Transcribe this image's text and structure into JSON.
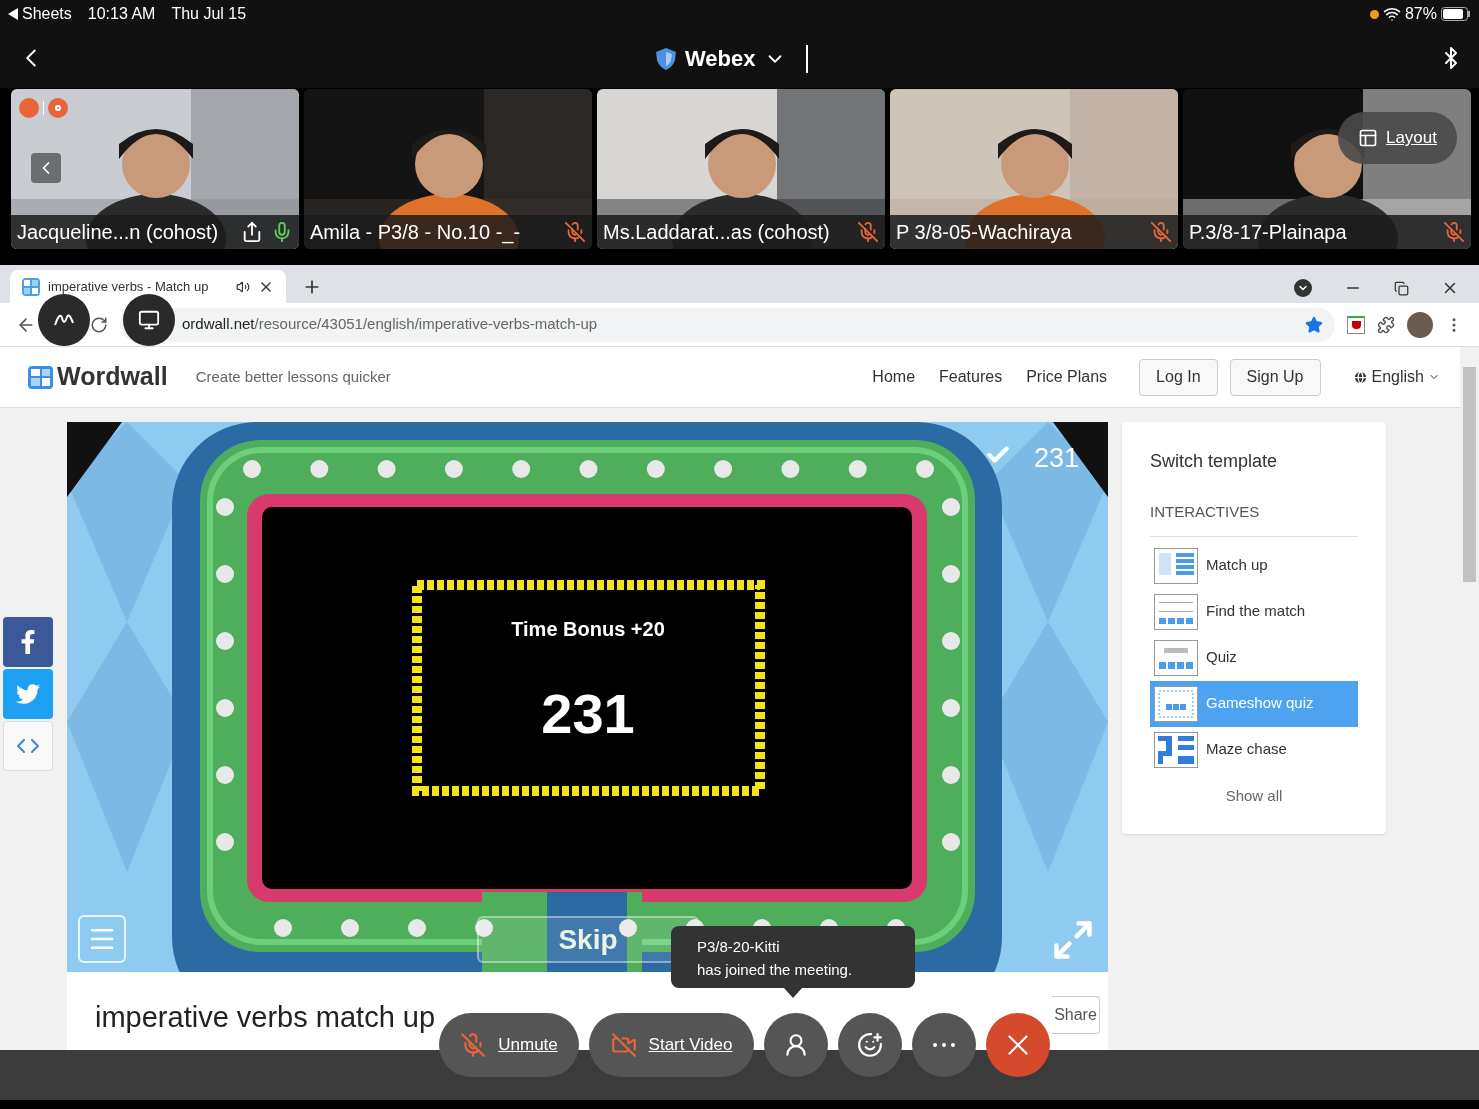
{
  "status_bar": {
    "back_app": "Sheets",
    "time": "10:13 AM",
    "date": "Thu Jul 15",
    "battery": "87%"
  },
  "meeting_header": {
    "title": "Webex"
  },
  "participants": [
    {
      "name": "Jacqueline...n (cohost)",
      "muted": false,
      "presenting": true
    },
    {
      "name": "Amila - P3/8 - No.10 -_-",
      "muted": true,
      "presenting": false
    },
    {
      "name": "Ms.Laddarat...as (cohost)",
      "muted": true,
      "presenting": false
    },
    {
      "name": "P 3/8-05-Wachiraya",
      "muted": true,
      "presenting": false
    },
    {
      "name": "P.3/8-17-Plainapa",
      "muted": true,
      "presenting": false
    }
  ],
  "layout_button": "Layout",
  "browser": {
    "tab_title": "imperative verbs - Match up",
    "url_host": "ordwall.net",
    "url_path": "/resource/43051/english/imperative-verbs-match-up"
  },
  "site_header": {
    "logo": "Wordwall",
    "tagline": "Create better lessons quicker",
    "nav": [
      "Home",
      "Features",
      "Price Plans"
    ],
    "buttons": [
      "Log In",
      "Sign Up"
    ],
    "language": "English"
  },
  "game": {
    "score": "231",
    "bonus_label": "Time Bonus +20",
    "bonus_score": "231",
    "skip": "Skip"
  },
  "activity_title": "imperative verbs match up",
  "share_button": "Share",
  "switch_template": {
    "title": "Switch template",
    "section": "INTERACTIVES",
    "items": [
      {
        "label": "Match up",
        "selected": false
      },
      {
        "label": "Find the match",
        "selected": false
      },
      {
        "label": "Quiz",
        "selected": false
      },
      {
        "label": "Gameshow quiz",
        "selected": true
      },
      {
        "label": "Maze chase",
        "selected": false
      }
    ],
    "show_all": "Show all"
  },
  "toast": {
    "name": "P3/8-20-Kitti",
    "message": "has joined the meeting."
  },
  "controls": {
    "unmute": "Unmute",
    "start_video": "Start Video"
  }
}
